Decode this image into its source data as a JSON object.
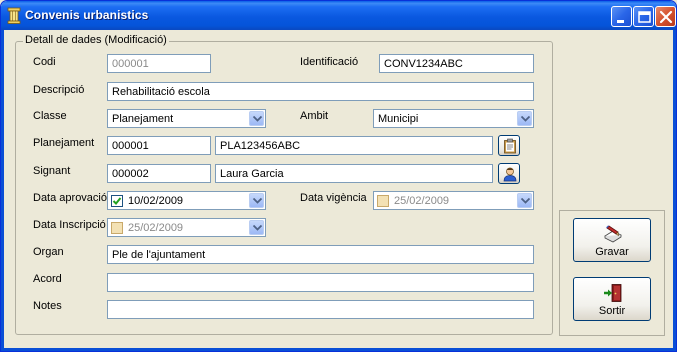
{
  "window": {
    "title": "Convenis urbanistics"
  },
  "group": {
    "title": "Detall de dades (Modificació)"
  },
  "fields": {
    "codi": {
      "label": "Codi",
      "value": "000001"
    },
    "identificacio": {
      "label": "Identificació",
      "value": "CONV1234ABC"
    },
    "descripcio": {
      "label": "Descripció",
      "value": "Rehabilitació escola"
    },
    "classe": {
      "label": "Classe",
      "value": "Planejament"
    },
    "ambit": {
      "label": "Ambit",
      "value": "Municipi"
    },
    "planejament": {
      "label": "Planejament",
      "code": "000001",
      "name": "PLA123456ABC"
    },
    "signant": {
      "label": "Signant",
      "code": "000002",
      "name": "Laura Garcia"
    },
    "data_aprovacio": {
      "label": "Data aprovació",
      "value": "10/02/2009",
      "checked": true
    },
    "data_vigencia": {
      "label": "Data vigència",
      "value": "25/02/2009",
      "checked": false
    },
    "data_inscripcio": {
      "label": "Data Inscripció",
      "value": "25/02/2009",
      "checked": false
    },
    "organ": {
      "label": "Organ",
      "value": "Ple de l'ajuntament"
    },
    "acord": {
      "label": "Acord",
      "value": ""
    },
    "notes": {
      "label": "Notes",
      "value": ""
    }
  },
  "buttons": {
    "gravar": "Gravar",
    "sortir": "Sortir"
  },
  "icons": {
    "app": "pillar-icon",
    "planejament_lookup": "clipboard-icon",
    "signant_lookup": "user-icon",
    "gravar": "pencil-paper-icon",
    "sortir": "exit-door-icon"
  },
  "colors": {
    "titlebar": "#0a5fe8",
    "frame": "#0a4fd6",
    "background": "#ece9d8",
    "close_button": "#d5532f"
  }
}
